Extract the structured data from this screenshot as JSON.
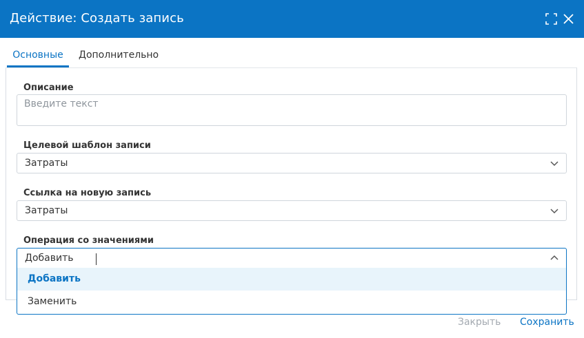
{
  "dialog": {
    "title": "Действие: Создать запись"
  },
  "tabs": [
    {
      "label": "Основные",
      "active": true
    },
    {
      "label": "Дополнительно",
      "active": false
    }
  ],
  "fields": {
    "description": {
      "label": "Описание",
      "value": "",
      "placeholder": "Введите текст"
    },
    "target_template": {
      "label": "Целевой шаблон записи",
      "value": "Затраты"
    },
    "new_record_link": {
      "label": "Ссылка на новую запись",
      "value": "Затраты"
    },
    "value_operation": {
      "label": "Операция со значениями",
      "value": "Добавить",
      "options": [
        "Добавить",
        "Заменить"
      ]
    }
  },
  "footer": {
    "close_label": "Закрыть",
    "save_label": "Сохранить"
  },
  "colors": {
    "accent": "#0b74c4",
    "option_highlight": "#e8f4fb",
    "disabled_text": "#a3a9b0"
  },
  "icons": {
    "expand": "expand-icon",
    "close": "close-icon",
    "chevron_down": "chevron-down-icon",
    "chevron_up": "chevron-up-icon"
  }
}
